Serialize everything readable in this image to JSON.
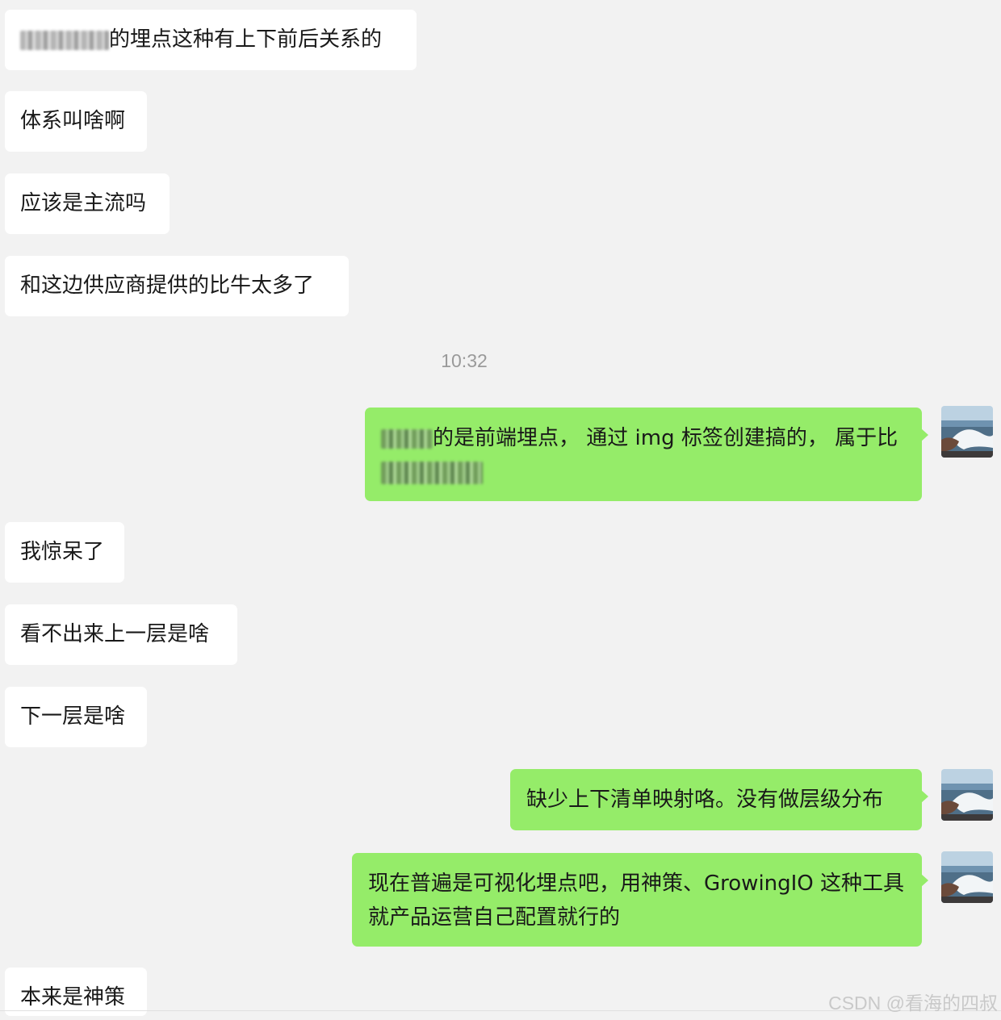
{
  "messages": [
    {
      "side": "in",
      "text": "的埋点这种有上下前后关系的",
      "redacted_prefix": true
    },
    {
      "side": "in",
      "text": "体系叫啥啊"
    },
    {
      "side": "in",
      "text": "应该是主流吗"
    },
    {
      "side": "in",
      "text": "和这边供应商提供的比牛太多了"
    },
    {
      "side": "out",
      "text": "的是前端埋点， 通过 img 标签创建搞的， 属于比",
      "redacted_prefix": true,
      "redacted_line2": true
    },
    {
      "side": "in",
      "text": "我惊呆了"
    },
    {
      "side": "in",
      "text": "看不出来上一层是啥"
    },
    {
      "side": "in",
      "text": "下一层是啥"
    },
    {
      "side": "out",
      "text": "缺少上下清单映射咯。没有做层级分布"
    },
    {
      "side": "out",
      "text": "现在普遍是可视化埋点吧，用神策、GrowingIO 这种工具   就产品运营自己配置就行的"
    },
    {
      "side": "in",
      "text": "本来是神策"
    }
  ],
  "timestamp": "10:32",
  "watermark": "CSDN @看海的四叔",
  "colors": {
    "background": "#f2f2f2",
    "incoming_bubble": "#ffffff",
    "outgoing_bubble": "#95ec69",
    "text": "#191919",
    "timestamp": "#9a9a9a"
  },
  "icons": {
    "avatar": "seascape-avatar-icon"
  }
}
